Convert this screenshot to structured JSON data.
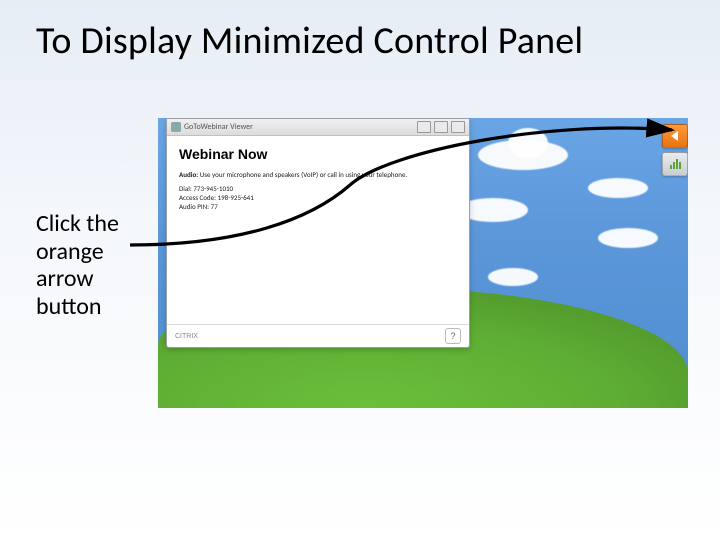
{
  "title": "To Display Minimized Control Panel",
  "instruction": "Click the orange arrow button",
  "viewer": {
    "titlebar": "GoToWebinar Viewer",
    "heading": "Webinar Now",
    "audio_label": "Audio:",
    "audio_text": "Use your microphone and speakers (VoIP) or call in using your telephone.",
    "dial_label": "Dial:",
    "dial_value": "773-945-1010",
    "access_label": "Access Code:",
    "access_value": "198-925-641",
    "pin_label": "Audio PIN:",
    "pin_value": "77",
    "footer_brand": "CİTRIX",
    "footer_help": "?"
  },
  "mini_panel": {
    "expand_name": "expand-arrow-icon",
    "audio_name": "audio-levels-icon"
  }
}
